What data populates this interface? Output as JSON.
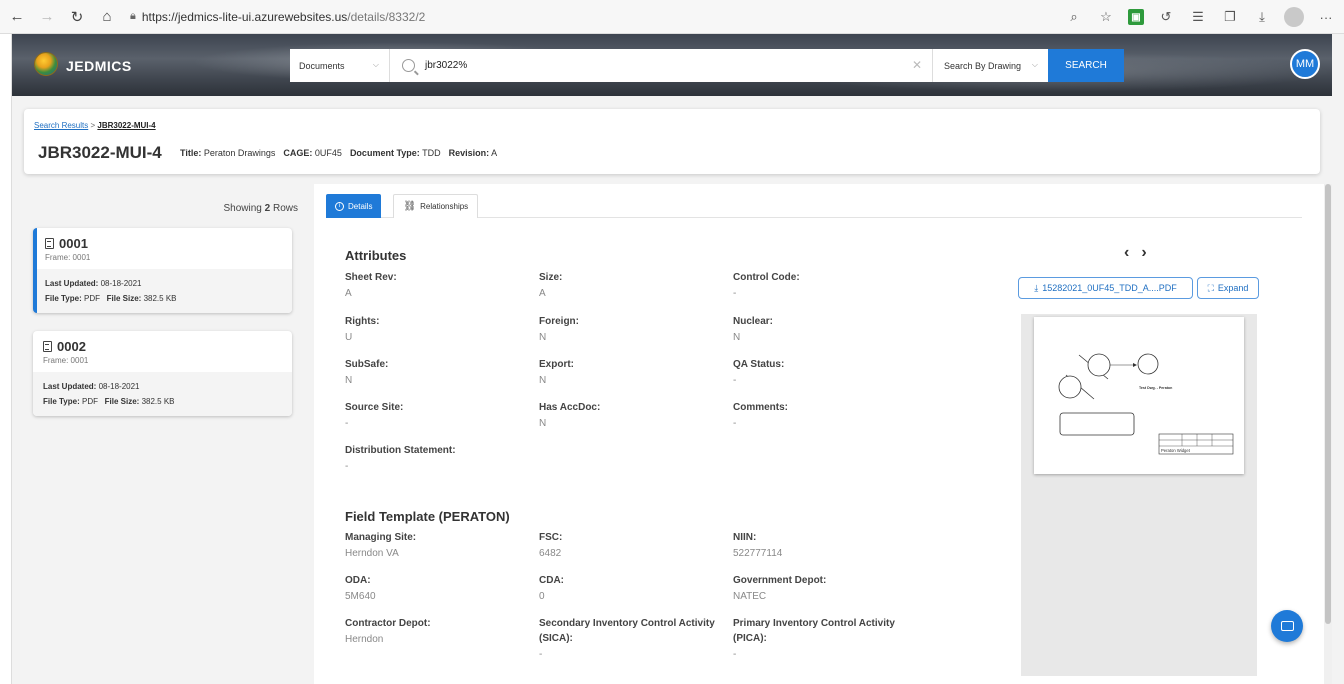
{
  "browser": {
    "url_host": "https://jedmics-lite-ui.azurewebsites.us",
    "url_path": "/details/8332/2",
    "more_label": "···"
  },
  "header": {
    "brand": "JEDMICS",
    "category_select": "Documents",
    "search_query": "jbr3022%",
    "search_by_select": "Search By Drawing",
    "search_button": "SEARCH",
    "avatar_initials": "MM"
  },
  "doc": {
    "breadcrumb_root": "Search Results",
    "breadcrumb_sep": ">",
    "breadcrumb_current": "JBR3022-MUI-4",
    "id": "JBR3022-MUI-4",
    "title_label": "Title:",
    "title_value": "Peraton Drawings",
    "cage_label": "CAGE:",
    "cage_value": "0UF45",
    "doctype_label": "Document Type:",
    "doctype_value": "TDD",
    "revision_label": "Revision:",
    "revision_value": "A"
  },
  "list": {
    "showing_prefix": "Showing",
    "showing_count": "2",
    "showing_suffix": "Rows",
    "items": [
      {
        "title": "0001",
        "frame": "Frame: 0001",
        "updated_label": "Last Updated:",
        "updated": "08-18-2021",
        "filetype_label": "File Type:",
        "filetype": "PDF",
        "filesize_label": "File Size:",
        "filesize": "382.5 KB"
      },
      {
        "title": "0002",
        "frame": "Frame: 0001",
        "updated_label": "Last Updated:",
        "updated": "08-18-2021",
        "filetype_label": "File Type:",
        "filetype": "PDF",
        "filesize_label": "File Size:",
        "filesize": "382.5 KB"
      }
    ]
  },
  "tabs": {
    "details": "Details",
    "relationships": "Relationships"
  },
  "attributes": {
    "title": "Attributes",
    "fields": [
      {
        "label": "Sheet Rev:",
        "value": "A"
      },
      {
        "label": "Size:",
        "value": "A"
      },
      {
        "label": "Control Code:",
        "value": "-"
      },
      {
        "label": "Rights:",
        "value": "U"
      },
      {
        "label": "Foreign:",
        "value": "N"
      },
      {
        "label": "Nuclear:",
        "value": "N"
      },
      {
        "label": "SubSafe:",
        "value": "N"
      },
      {
        "label": "Export:",
        "value": "N"
      },
      {
        "label": "QA Status:",
        "value": "-"
      },
      {
        "label": "Source Site:",
        "value": "-"
      },
      {
        "label": "Has AccDoc:",
        "value": "N"
      },
      {
        "label": "Comments:",
        "value": "-"
      },
      {
        "label": "Distribution Statement:",
        "value": "-"
      }
    ]
  },
  "template": {
    "title": "Field Template  (PERATON)",
    "fields": [
      {
        "label": "Managing Site:",
        "value": "Herndon VA"
      },
      {
        "label": "FSC:",
        "value": "6482"
      },
      {
        "label": "NIIN:",
        "value": "522777114"
      },
      {
        "label": "ODA:",
        "value": "5M640"
      },
      {
        "label": "CDA:",
        "value": "0"
      },
      {
        "label": "Government Depot:",
        "value": "NATEC"
      },
      {
        "label": "Contractor Depot:",
        "value": "Herndon"
      },
      {
        "label": "Secondary Inventory Control Activity (SICA):",
        "value": "-"
      },
      {
        "label": "Primary Inventory Control Activity (PICA):",
        "value": "-"
      }
    ]
  },
  "viewer": {
    "prev": "‹",
    "next": "›",
    "pdf_button": "15282021_0UF45_TDD_A....PDF",
    "expand_button": "Expand",
    "preview_caption": "Test Dwg. - Peraton",
    "preview_block": "Peraton Widget"
  },
  "colors": {
    "accent": "#1f7ad8",
    "header_dark": "#3d4450"
  }
}
